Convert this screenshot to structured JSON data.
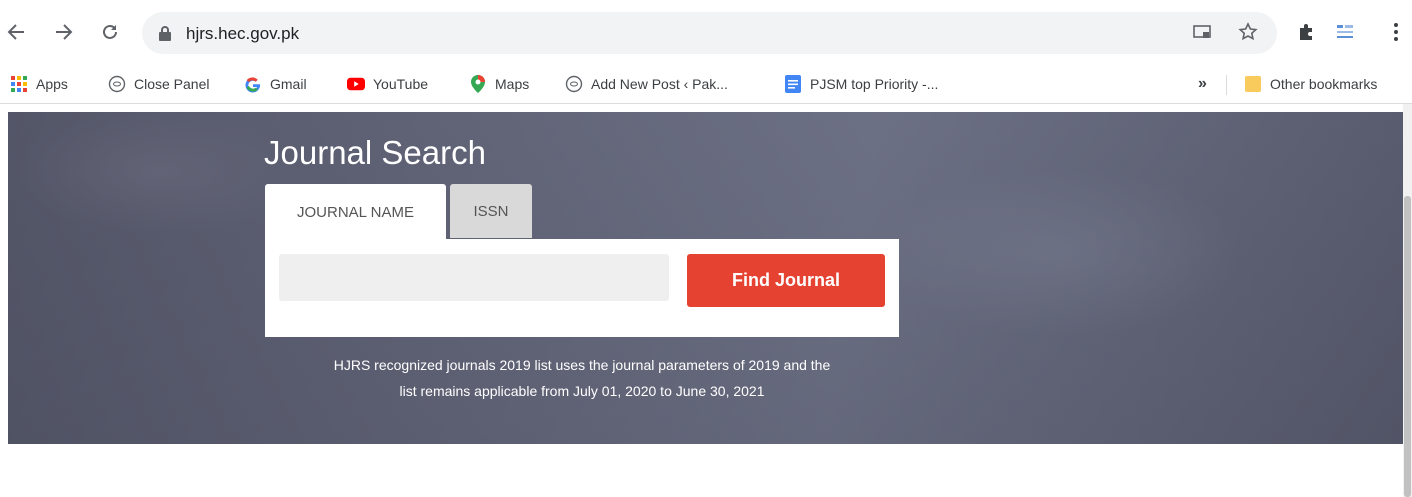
{
  "browser": {
    "url": "hjrs.hec.gov.pk"
  },
  "bookmarks": {
    "items": [
      {
        "label": "Apps",
        "icon": "apps-grid-icon"
      },
      {
        "label": "Close Panel",
        "icon": "globe-icon"
      },
      {
        "label": "Gmail",
        "icon": "google-g-icon"
      },
      {
        "label": "YouTube",
        "icon": "youtube-icon"
      },
      {
        "label": "Maps",
        "icon": "maps-pin-icon"
      },
      {
        "label": "Add New Post ‹ Pak...",
        "icon": "globe-icon"
      },
      {
        "label": "PJSM top Priority -...",
        "icon": "docs-icon"
      }
    ],
    "overflow": "»",
    "other": "Other bookmarks"
  },
  "hero": {
    "title": "Journal Search",
    "tabs": [
      {
        "label": "JOURNAL NAME",
        "active": true
      },
      {
        "label": "ISSN",
        "active": false
      }
    ],
    "search_placeholder": "",
    "find_button": "Find Journal",
    "notice_line1": "HJRS recognized journals 2019 list uses the journal parameters of 2019 and the",
    "notice_line2": "list remains applicable from July 01, 2020 to June 30, 2021"
  },
  "colors": {
    "accent_button": "#e64232",
    "hero_overlay": "#6d7084"
  }
}
